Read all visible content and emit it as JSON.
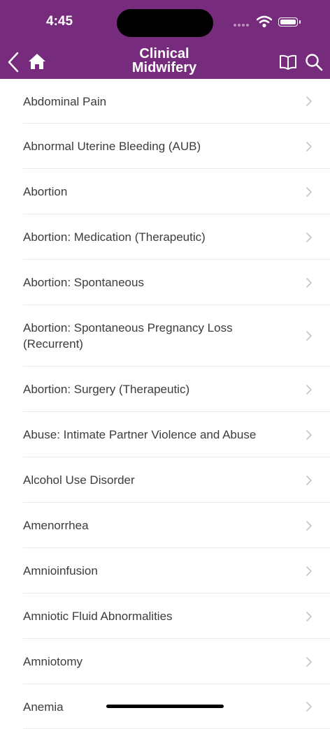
{
  "status": {
    "time": "4:45"
  },
  "header": {
    "title_line1": "Clinical",
    "title_line2": "Midwifery"
  },
  "icons": {
    "back": "chevron-left-icon",
    "home": "home-icon",
    "book": "open-book-icon",
    "search": "search-icon",
    "row_chevron": "chevron-right-icon"
  },
  "colors": {
    "header_bg": "#762b7c",
    "text": "#3c3c3c",
    "chevron": "#c4c4c4",
    "divider": "#eaeaea"
  },
  "list": {
    "items": [
      {
        "label": "Abdominal Pain"
      },
      {
        "label": "Abnormal Uterine Bleeding (AUB)"
      },
      {
        "label": "Abortion"
      },
      {
        "label": "Abortion: Medication (Therapeutic)"
      },
      {
        "label": "Abortion: Spontaneous"
      },
      {
        "label": "Abortion: Spontaneous Pregnancy Loss (Recurrent)"
      },
      {
        "label": "Abortion: Surgery (Therapeutic)"
      },
      {
        "label": "Abuse: Intimate Partner Violence and Abuse"
      },
      {
        "label": "Alcohol Use Disorder"
      },
      {
        "label": "Amenorrhea"
      },
      {
        "label": "Amnioinfusion"
      },
      {
        "label": "Amniotic Fluid Abnormalities"
      },
      {
        "label": "Amniotomy"
      },
      {
        "label": "Anemia"
      }
    ]
  }
}
